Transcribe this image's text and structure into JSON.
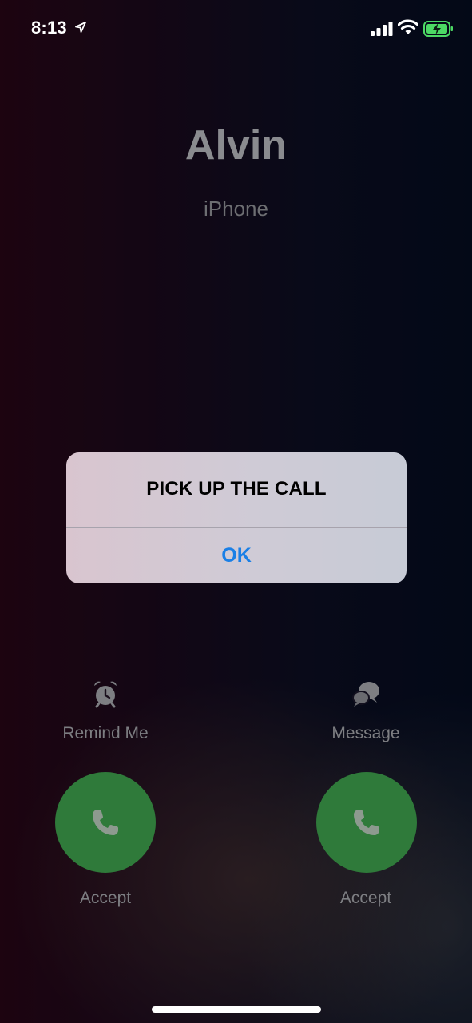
{
  "status_bar": {
    "time": "8:13",
    "battery_color": "#4cd964"
  },
  "caller": {
    "name": "Alvin",
    "subtitle": "iPhone"
  },
  "alert": {
    "title": "PICK UP THE CALL",
    "ok_label": "OK"
  },
  "actions": {
    "remind": {
      "label": "Remind Me",
      "icon": "alarm-clock-icon"
    },
    "message": {
      "label": "Message",
      "icon": "message-bubbles-icon"
    }
  },
  "buttons": {
    "accept_left": {
      "label": "Accept",
      "icon": "phone-icon"
    },
    "accept_right": {
      "label": "Accept",
      "icon": "phone-icon"
    }
  },
  "colors": {
    "accept_green": "#2f7a3a",
    "ok_blue": "#1a7fe6"
  }
}
